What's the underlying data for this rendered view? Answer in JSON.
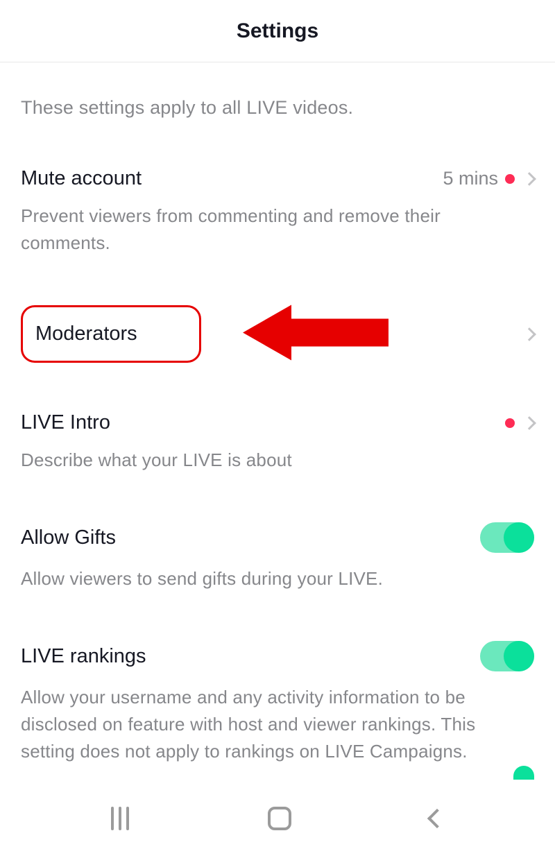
{
  "header": {
    "title": "Settings"
  },
  "intro": "These settings apply to all LIVE videos.",
  "items": {
    "mute": {
      "title": "Mute account",
      "value": "5 mins",
      "desc": "Prevent viewers from commenting and remove their comments."
    },
    "moderators": {
      "title": "Moderators"
    },
    "liveIntro": {
      "title": "LIVE Intro",
      "desc": "Describe what your LIVE is about"
    },
    "allowGifts": {
      "title": "Allow Gifts",
      "desc": "Allow viewers to send gifts during your LIVE."
    },
    "liveRankings": {
      "title": "LIVE rankings",
      "desc": "Allow your username and any activity information to be disclosed on feature with host and viewer rankings. This setting does not apply to rankings on LIVE Campaigns."
    }
  }
}
